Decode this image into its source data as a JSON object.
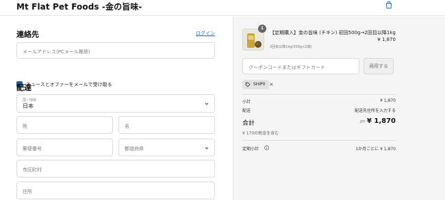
{
  "header": {
    "store_title": "Mt Flat Pet Foods -金の旨味-",
    "bag_icon": "shopping-bag-icon"
  },
  "contact": {
    "heading": "連絡先",
    "login_link": "ログイン",
    "email_placeholder": "メールアドレス(PCメール推奨)",
    "newsletter_label": "ニュースとオファーをメールで受け取る",
    "newsletter_checked": true
  },
  "delivery": {
    "heading": "配達",
    "country_label": "国 / 地域",
    "country_value": "日本",
    "last_name_placeholder": "姓",
    "first_name_placeholder": "名",
    "postal_placeholder": "郵便番号",
    "prefecture_placeholder": "都道府県",
    "city_placeholder": "市区町村",
    "address_placeholder": "住所"
  },
  "summary": {
    "item": {
      "quantity_badge": "1",
      "name": "【定期購入】金の旨味 (チキン) 初回500g→2回目以降1kg",
      "variant": "2回目以降1kg(500g×2袋)",
      "price": "¥ 1,870"
    },
    "coupon_placeholder": "クーポンコードまたはギフトカード",
    "apply_button": "適用する",
    "discount_tag": "SHIP0",
    "subtotal_label": "小計",
    "subtotal_value": "¥ 1,870",
    "shipping_label": "配送",
    "shipping_value": "配送先住所を入力する",
    "total_label": "合計",
    "total_currency": "JPY",
    "total_value": "¥ 1,870",
    "tax_note": "¥ 170の税金を含む",
    "recurring_label": "定期小計",
    "recurring_value": "1か月ごとに ¥ 1,870"
  },
  "colors": {
    "accent": "#1b5fa8",
    "link": "#1a64c8",
    "summary_bg": "#f5f5f5"
  }
}
